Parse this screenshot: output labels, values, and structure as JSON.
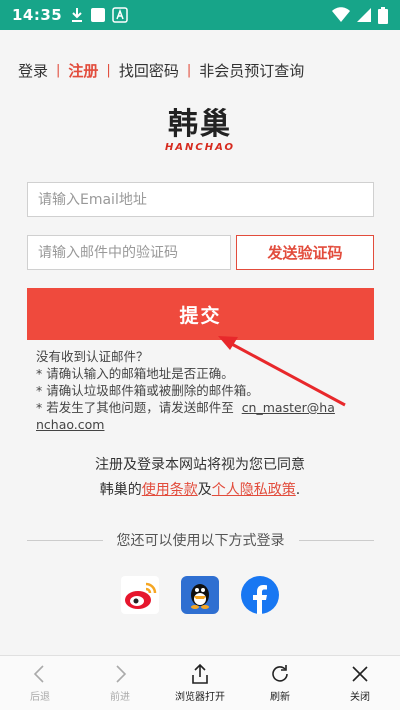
{
  "statusbar": {
    "time": "14:35"
  },
  "nav": {
    "login": "登录",
    "register": "注册",
    "recover": "找回密码",
    "guest": "非会员预订查询",
    "sep": "|"
  },
  "logo": {
    "cn": "韩巢",
    "en": "HANCHAO"
  },
  "form": {
    "email_placeholder": "请输入Email地址",
    "code_placeholder": "请输入邮件中的验证码",
    "send_code": "发送验证码",
    "submit": "提交"
  },
  "help": {
    "title": "没有收到认证邮件？",
    "line1": "* 请确认输入的邮箱地址是否正确。",
    "line2": "* 请确认垃圾邮件箱或被删除的邮件箱。",
    "line3_prefix": "* 若发生了其他问题，请发送邮件至",
    "email_a": "cn_master@ha",
    "email_b": "nchao.com"
  },
  "agree": {
    "line1": "注册及登录本网站将视为您已同意",
    "prefix": "韩巢的",
    "terms": "使用条款",
    "and": "及",
    "privacy": "个人隐私政策",
    "end": "."
  },
  "divider": {
    "text": "您还可以使用以下方式登录"
  },
  "toolbar": {
    "back": "后退",
    "forward": "前进",
    "open_browser": "浏览器打开",
    "refresh": "刷新",
    "close": "关闭"
  },
  "colors": {
    "statusbar": "#17a589",
    "accent": "#ef4a3d"
  }
}
